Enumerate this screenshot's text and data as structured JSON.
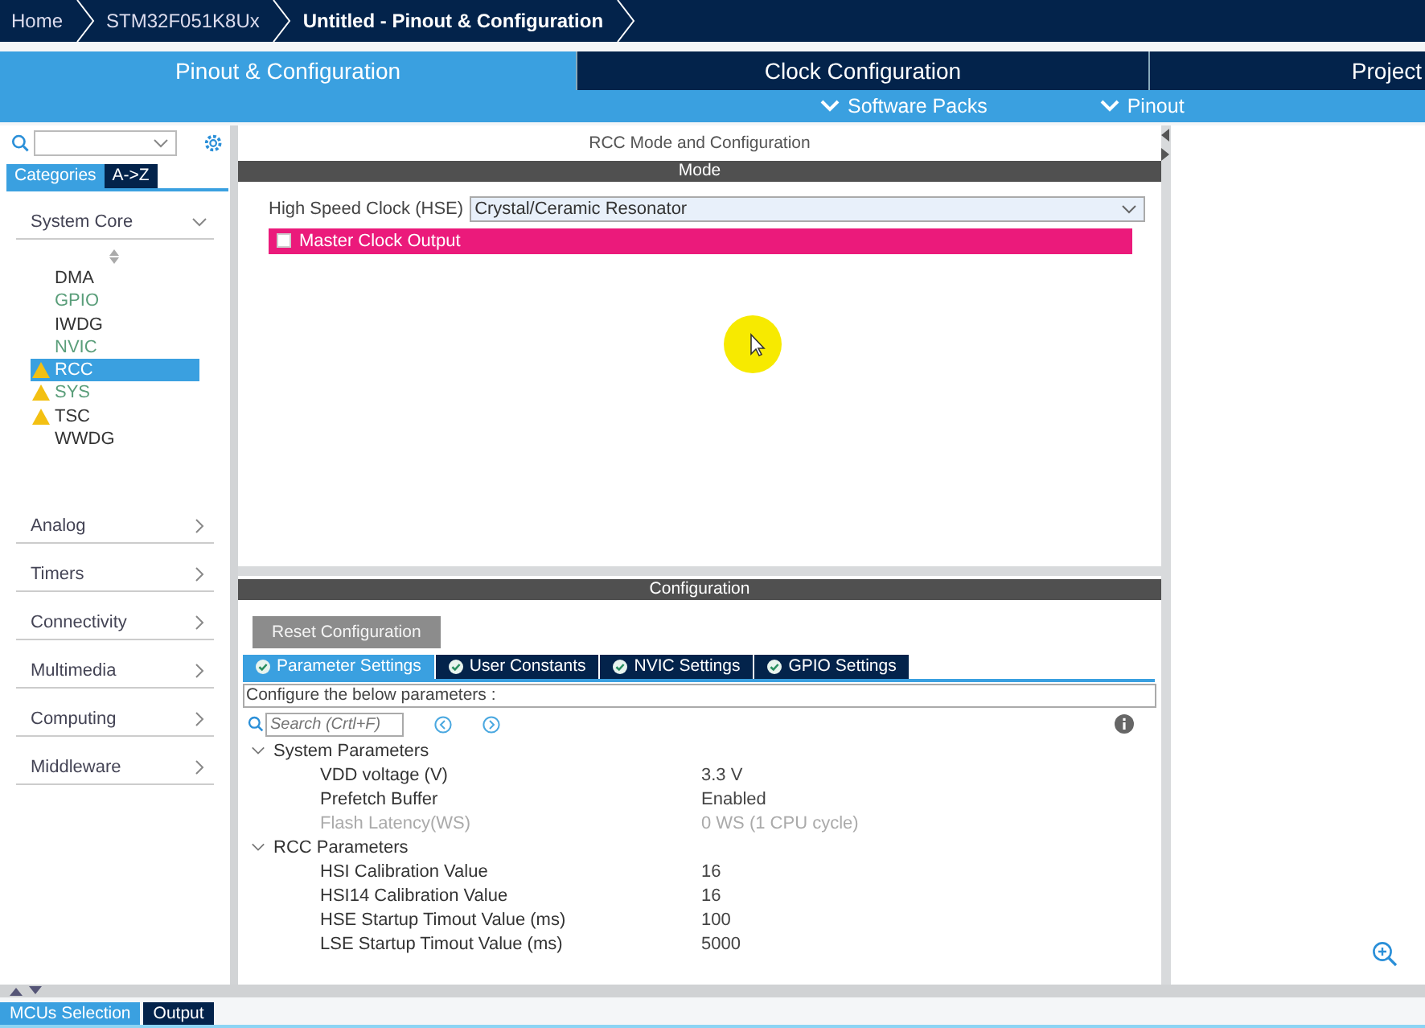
{
  "breadcrumbs": [
    {
      "label": "Home",
      "current": false
    },
    {
      "label": "STM32F051K8Ux",
      "current": false
    },
    {
      "label": "Untitled - Pinout & Configuration",
      "current": true
    }
  ],
  "main_tabs": [
    {
      "label": "Pinout & Configuration",
      "selected": true
    },
    {
      "label": "Clock Configuration",
      "selected": false
    },
    {
      "label": "Project",
      "selected": false
    }
  ],
  "sub_menus": [
    "Software Packs",
    "Pinout"
  ],
  "sidebar": {
    "view_tabs": [
      {
        "label": "Categories",
        "selected": true
      },
      {
        "label": "A->Z",
        "selected": false
      }
    ],
    "categories": [
      {
        "label": "System Core",
        "expanded": true,
        "items": [
          {
            "label": "DMA",
            "configured": false,
            "warning": false,
            "selected": false
          },
          {
            "label": "GPIO",
            "configured": true,
            "warning": false,
            "selected": false
          },
          {
            "label": "IWDG",
            "configured": false,
            "warning": false,
            "selected": false
          },
          {
            "label": "NVIC",
            "configured": true,
            "warning": false,
            "selected": false
          },
          {
            "label": "RCC",
            "configured": false,
            "warning": true,
            "selected": true
          },
          {
            "label": "SYS",
            "configured": true,
            "warning": true,
            "selected": false
          },
          {
            "label": "TSC",
            "configured": false,
            "warning": true,
            "selected": false
          },
          {
            "label": "WWDG",
            "configured": false,
            "warning": false,
            "selected": false
          }
        ]
      },
      {
        "label": "Analog",
        "expanded": false
      },
      {
        "label": "Timers",
        "expanded": false
      },
      {
        "label": "Connectivity",
        "expanded": false
      },
      {
        "label": "Multimedia",
        "expanded": false
      },
      {
        "label": "Computing",
        "expanded": false
      },
      {
        "label": "Middleware",
        "expanded": false
      }
    ]
  },
  "panel_title": "RCC Mode and Configuration",
  "mode": {
    "header": "Mode",
    "hse_label": "High Speed Clock (HSE)",
    "hse_value": "Crystal/Ceramic Resonator",
    "mco_label": "Master Clock Output",
    "mco_checked": false
  },
  "configuration": {
    "header": "Configuration",
    "reset_button": "Reset Configuration",
    "tabs": [
      {
        "label": "Parameter Settings",
        "selected": true
      },
      {
        "label": "User Constants",
        "selected": false
      },
      {
        "label": "NVIC Settings",
        "selected": false
      },
      {
        "label": "GPIO Settings",
        "selected": false
      }
    ],
    "hint": "Configure the below parameters :",
    "search_placeholder": "Search (Crtl+F)",
    "groups": [
      {
        "label": "System Parameters",
        "expanded": true,
        "children": [
          {
            "name": "VDD voltage (V)",
            "value": "3.3 V",
            "disabled": false
          },
          {
            "name": "Prefetch Buffer",
            "value": "Enabled",
            "disabled": false
          },
          {
            "name": "Flash Latency(WS)",
            "value": "0 WS (1 CPU cycle)",
            "disabled": true
          }
        ]
      },
      {
        "label": "RCC Parameters",
        "expanded": true,
        "children": [
          {
            "name": "HSI Calibration Value",
            "value": "16",
            "disabled": false
          },
          {
            "name": "HSI14 Calibration Value",
            "value": "16",
            "disabled": false
          },
          {
            "name": "HSE Startup Timout Value (ms)",
            "value": "100",
            "disabled": false
          },
          {
            "name": "LSE Startup Timout Value (ms)",
            "value": "5000",
            "disabled": false
          }
        ]
      }
    ]
  },
  "bottom_tabs": [
    {
      "label": "MCUs Selection",
      "selected": true
    },
    {
      "label": "Output",
      "selected": false
    }
  ]
}
